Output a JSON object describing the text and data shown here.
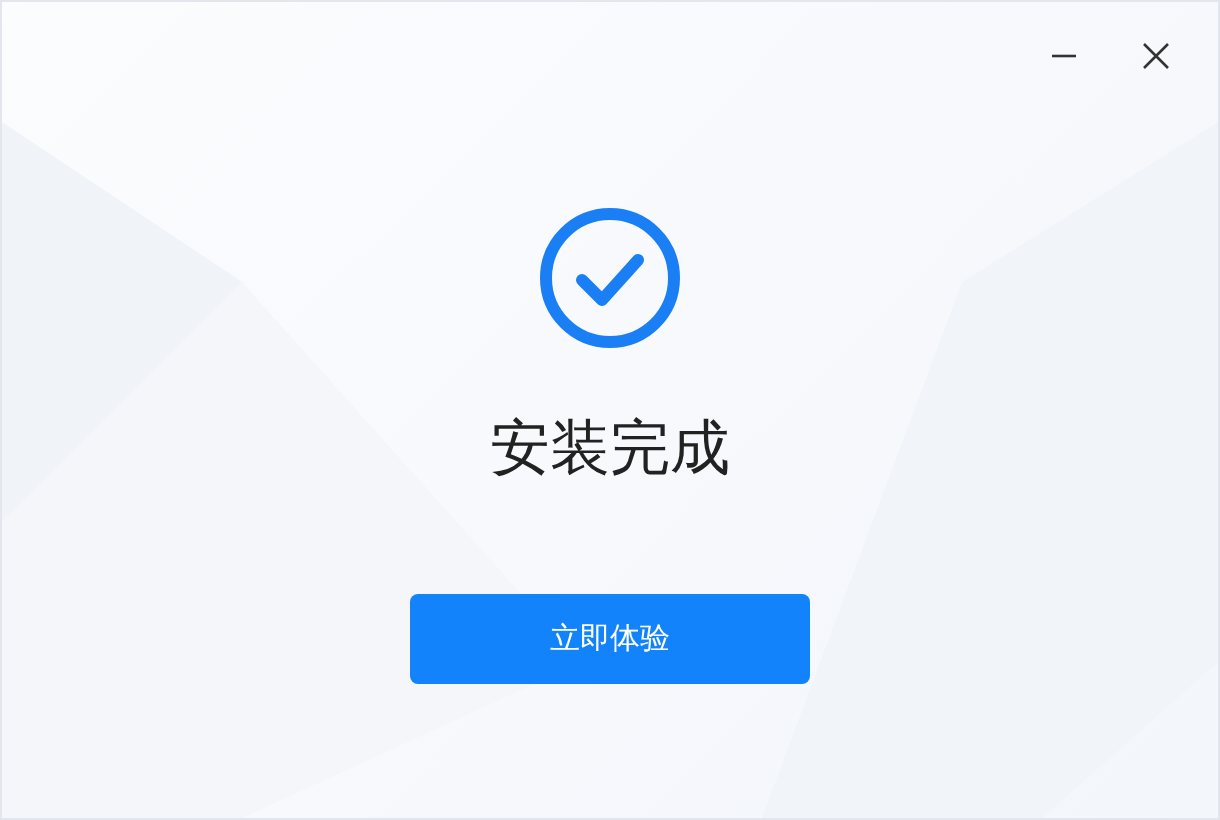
{
  "heading": "安装完成",
  "primary_button": {
    "label": "立即体验"
  }
}
